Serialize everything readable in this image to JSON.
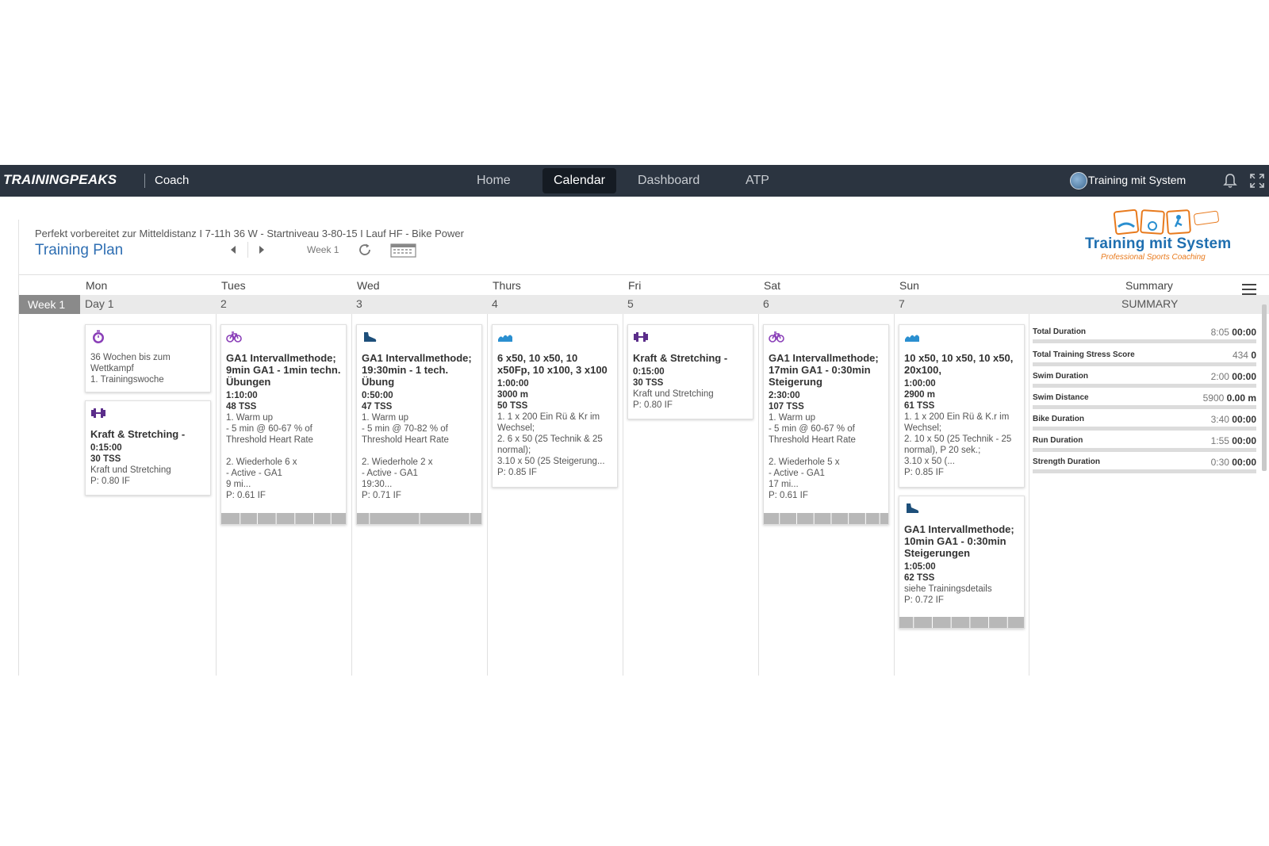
{
  "nav": {
    "brand": "TRAININGPEAKS",
    "brand_sub": "Coach",
    "tabs": [
      "Home",
      "Calendar",
      "Dashboard",
      "ATP"
    ],
    "user": "Training mit System"
  },
  "plan": {
    "description": "Perfekt vorbereitet zur Mitteldistanz I 7-11h 36 W - Startniveau 3-80-15 I Lauf HF - Bike Power",
    "title": "Training Plan",
    "week": "Week 1",
    "logo_text": "Training mit System",
    "logo_sub": "Professional Sports Coaching"
  },
  "calendar": {
    "week_label": "Week 1",
    "days": [
      "Mon",
      "Tues",
      "Wed",
      "Thurs",
      "Fri",
      "Sat",
      "Sun"
    ],
    "day_numbers": [
      "Day 1",
      "2",
      "3",
      "4",
      "5",
      "6",
      "7"
    ],
    "summary_head": "Summary",
    "summary_title": "SUMMARY"
  },
  "workouts": {
    "mon_note": {
      "icon": "stopwatch-icon",
      "text": "36 Wochen bis zum\nWettkampf\n1. Trainingswoche"
    },
    "mon_strength": {
      "icon": "dumbbell-icon",
      "title": "Kraft & Stretching -",
      "duration": "0:15:00",
      "tss": "30 TSS",
      "desc": "Kraft und Stretching",
      "if": "P: 0.80 IF"
    },
    "tue_bike": {
      "icon": "bike-icon",
      "title": "GA1 Intervallmethode; 9min GA1 - 1min techn. Übungen",
      "duration": "1:10:00",
      "tss": "48 TSS",
      "desc": "1. Warm up\n- 5 min @ 60-67 % of\nThreshold Heart Rate\n\n2. Wiederhole 6 x\n- Active - GA1\n9 mi...",
      "if": "P: 0.61 IF"
    },
    "wed_run": {
      "icon": "shoe-icon",
      "title": "GA1 Intervallmethode; 19:30min - 1 tech. Übung",
      "duration": "0:50:00",
      "tss": "47 TSS",
      "desc": "1. Warm up\n- 5 min @ 70-82 % of\nThreshold Heart Rate\n\n2. Wiederhole 2 x\n- Active - GA1\n19:30...",
      "if": "P: 0.71 IF"
    },
    "thu_swim": {
      "icon": "wave-icon",
      "title": "6 x50, 10 x50, 10 x50Fp, 10 x100, 3 x100",
      "duration": "1:00:00",
      "distance": "3000 m",
      "tss": "50 TSS",
      "desc": "1. 1 x 200 Ein Rü & Kr im\nWechsel;\n2. 6 x 50 (25 Technik & 25\nnormal);\n3.10 x 50 (25 Steigerung...",
      "if": "P: 0.85 IF"
    },
    "fri_strength": {
      "icon": "dumbbell-icon",
      "title": "Kraft & Stretching -",
      "duration": "0:15:00",
      "tss": "30 TSS",
      "desc": "Kraft und Stretching",
      "if": "P: 0.80 IF"
    },
    "sat_bike": {
      "icon": "bike-icon",
      "title": "GA1 Intervallmethode; 17min GA1 - 0:30min Steigerung",
      "duration": "2:30:00",
      "tss": "107 TSS",
      "desc": "1. Warm up\n- 5 min @ 60-67 % of\nThreshold Heart Rate\n\n2. Wiederhole 5 x\n- Active - GA1\n17 mi...",
      "if": "P: 0.61 IF"
    },
    "sun_swim": {
      "icon": "wave-icon",
      "title": "10 x50, 10 x50, 10 x50, 20x100,",
      "duration": "1:00:00",
      "distance": "2900 m",
      "tss": "61 TSS",
      "desc": "1. 1 x 200 Ein Rü & K.r im\nWechsel;\n2. 10 x 50 (25 Technik - 25\nnormal), P 20 sek.;\n3.10 x 50 (...",
      "if": "P: 0.85 IF"
    },
    "sun_run": {
      "icon": "shoe-icon",
      "title": "GA1 Intervallmethode; 10min GA1 - 0:30min Steigerungen",
      "duration": "1:05:00",
      "tss": "62 TSS",
      "desc": "siehe Trainingsdetails",
      "if": "P: 0.72 IF"
    }
  },
  "summary": [
    {
      "label": "Total Duration",
      "planned": "8:05",
      "actual": "00:00"
    },
    {
      "label": "Total Training Stress Score",
      "planned": "434",
      "actual": "0"
    },
    {
      "label": "Swim Duration",
      "planned": "2:00",
      "actual": "00:00"
    },
    {
      "label": "Swim Distance",
      "planned": "5900",
      "actual": "0.00 m"
    },
    {
      "label": "Bike Duration",
      "planned": "3:40",
      "actual": "00:00"
    },
    {
      "label": "Run Duration",
      "planned": "1:55",
      "actual": "00:00"
    },
    {
      "label": "Strength Duration",
      "planned": "0:30",
      "actual": "00:00"
    }
  ],
  "colors": {
    "nav_bg": "#2b3440",
    "bike": "#8a3fb8",
    "run": "#1d4f7a",
    "swim": "#2a8fd0",
    "strength": "#5b2d8a",
    "title_blue": "#2f6fb3"
  }
}
